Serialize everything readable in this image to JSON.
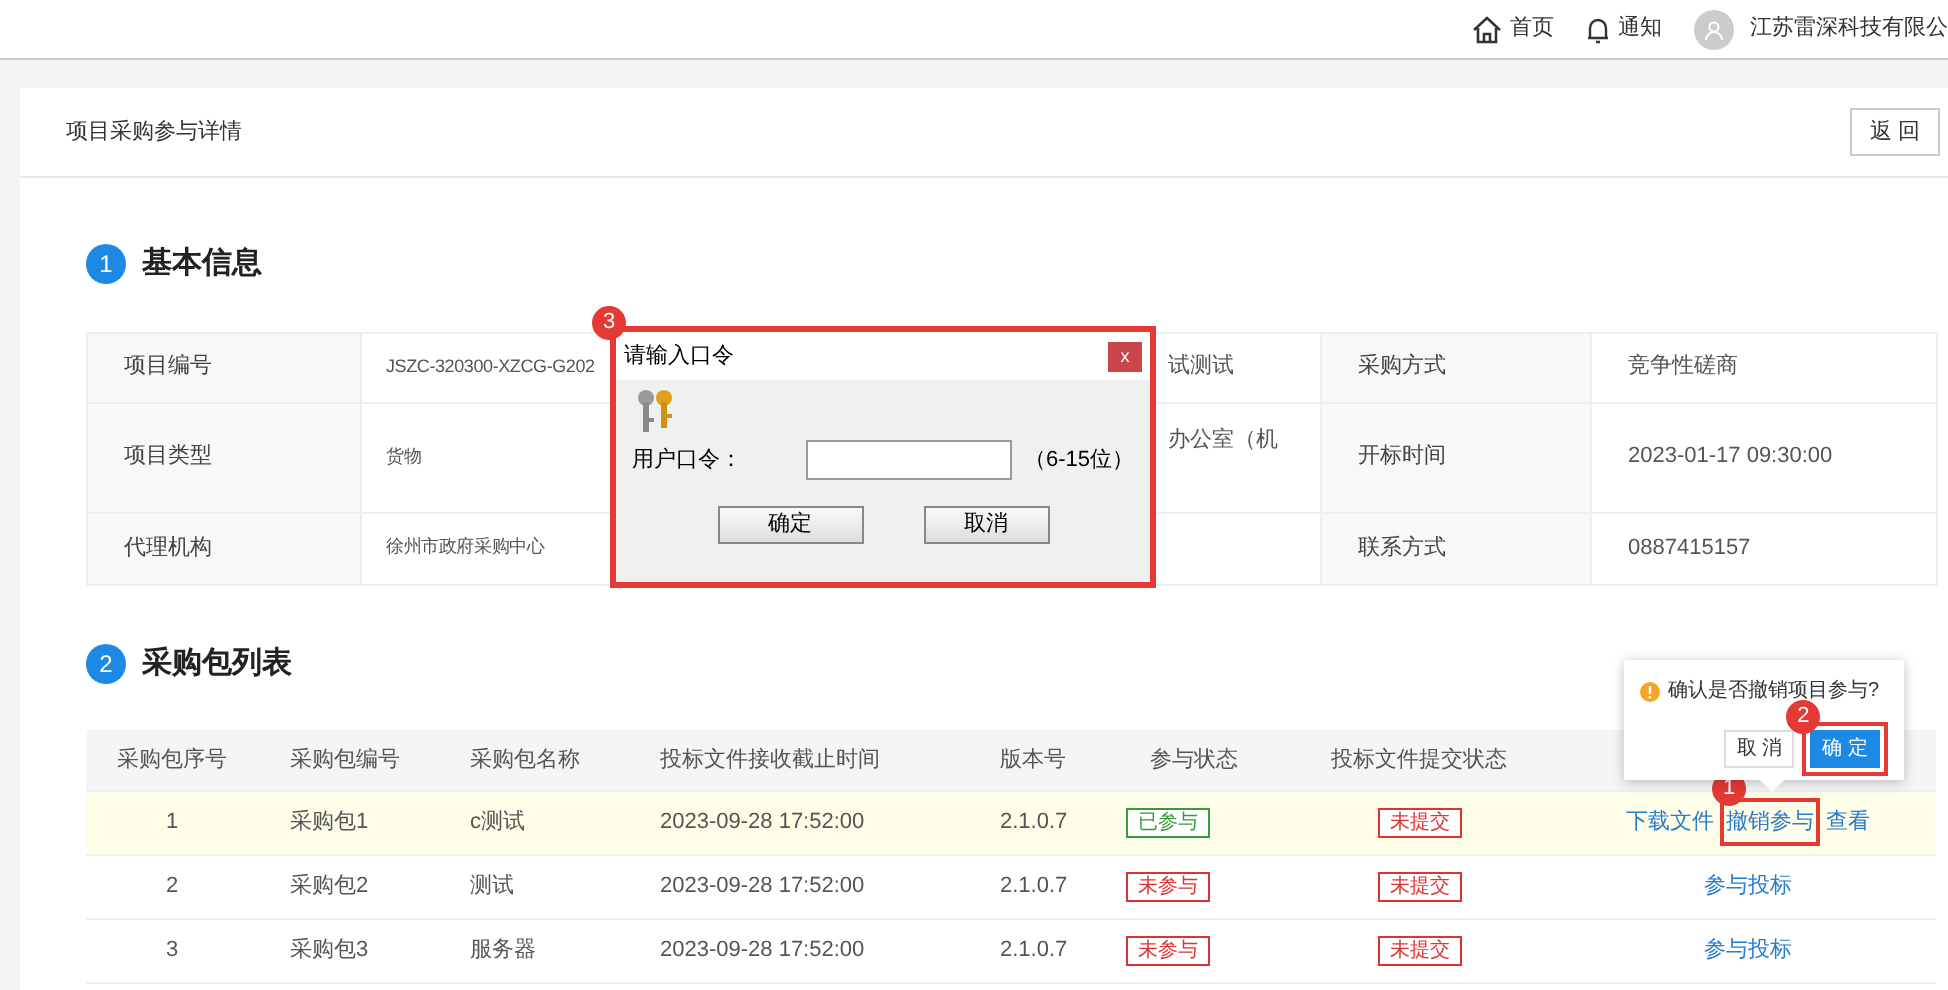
{
  "top_bar": {
    "home": "首页",
    "notifications": "通知",
    "company": "江苏雷深科技有限公"
  },
  "page": {
    "title": "项目采购参与详情",
    "back_button": "返 回"
  },
  "basic_info": {
    "number": "1",
    "title": "基本信息",
    "rows": [
      {
        "label_1": "项目编号",
        "value_1": "JSZC-320300-XZCG-G202",
        "value_2": "试测试",
        "label_3": "采购方式",
        "value_3": "竞争性磋商"
      },
      {
        "label_1": "项目类型",
        "value_1": "货物",
        "value_2": "办公室（机",
        "label_3": "开标时间",
        "value_3": "2023-01-17 09:30:00"
      },
      {
        "label_1": "代理机构",
        "value_1": "徐州市政府采购中心",
        "label_3": "联系方式",
        "value_3": "0887415157"
      }
    ]
  },
  "packages": {
    "number": "2",
    "title": "采购包列表",
    "columns": [
      "采购包序号",
      "采购包编号",
      "采购包名称",
      "投标文件接收截止时间",
      "版本号",
      "参与状态",
      "投标文件提交状态"
    ],
    "rows": [
      {
        "selected": true,
        "cells": [
          "1",
          "采购包1",
          "c测试",
          "2023-09-28 17:52:00",
          "2.1.0.7"
        ],
        "participation": {
          "text": "已参与",
          "color": "#3a9b3a"
        },
        "submission": {
          "text": "未提交",
          "color": "#dd3333"
        },
        "actions": [
          {
            "label": "下载文件"
          },
          {
            "label": "撤销参与",
            "annotation": "1"
          },
          {
            "label": "查看"
          }
        ]
      },
      {
        "selected": false,
        "cells": [
          "2",
          "采购包2",
          "测试",
          "2023-09-28 17:52:00",
          "2.1.0.7"
        ],
        "participation": {
          "text": "未参与",
          "color": "#dd3333"
        },
        "submission": {
          "text": "未提交",
          "color": "#dd3333"
        },
        "actions": [
          {
            "label": "参与投标"
          }
        ]
      },
      {
        "selected": false,
        "cells": [
          "3",
          "采购包3",
          "服务器",
          "2023-09-28 17:52:00",
          "2.1.0.7"
        ],
        "participation": {
          "text": "未参与",
          "color": "#dd3333"
        },
        "submission": {
          "text": "未提交",
          "color": "#dd3333"
        },
        "actions": [
          {
            "label": "参与投标"
          }
        ]
      }
    ]
  },
  "popover": {
    "message": "确认是否撤销项目参与?",
    "cancel": "取 消",
    "confirm": "确 定",
    "confirm_annotation": "2"
  },
  "dialog": {
    "annotation": "3",
    "title": "请输入口令",
    "close": "x",
    "field_label": "用户口令：",
    "hint": "（6-15位）",
    "ok": "确定",
    "cancel": "取消"
  }
}
